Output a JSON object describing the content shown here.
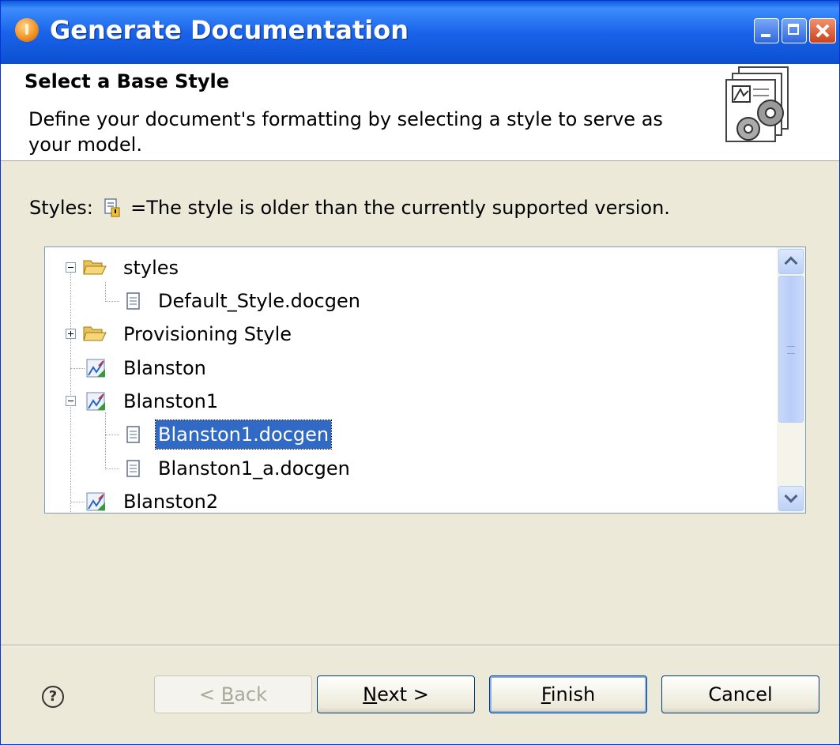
{
  "window": {
    "title": "Generate Documentation"
  },
  "header": {
    "title": "Select a Base Style",
    "description": "Define your document's formatting by selecting a style to serve as your model."
  },
  "legend": {
    "prefix": "Styles:",
    "text": "=The style is older than the currently supported version.",
    "icon": "outdated-style-icon"
  },
  "tree": {
    "items": [
      {
        "label": "styles",
        "icon": "folder-open-icon",
        "expanded": true
      },
      {
        "label": "Default_Style.docgen",
        "icon": "document-icon"
      },
      {
        "label": "Provisioning Style",
        "icon": "folder-open-icon",
        "expanded": false
      },
      {
        "label": "Blanston",
        "icon": "style-icon"
      },
      {
        "label": "Blanston1",
        "icon": "style-icon",
        "expanded": true
      },
      {
        "label": "Blanston1.docgen",
        "icon": "document-icon",
        "selected": true
      },
      {
        "label": "Blanston1_a.docgen",
        "icon": "document-icon"
      },
      {
        "label": "Blanston2",
        "icon": "style-icon"
      }
    ]
  },
  "buttons": {
    "back": {
      "pre": "< ",
      "u": "B",
      "post": "ack",
      "enabled": false
    },
    "next": {
      "u": "N",
      "post": "ext >"
    },
    "finish": {
      "u": "F",
      "post": "inish"
    },
    "cancel": "Cancel"
  },
  "colors": {
    "titlebar": "#0b4fd0",
    "dialog_bg": "#ece9d8",
    "selection": "#316ac5"
  }
}
